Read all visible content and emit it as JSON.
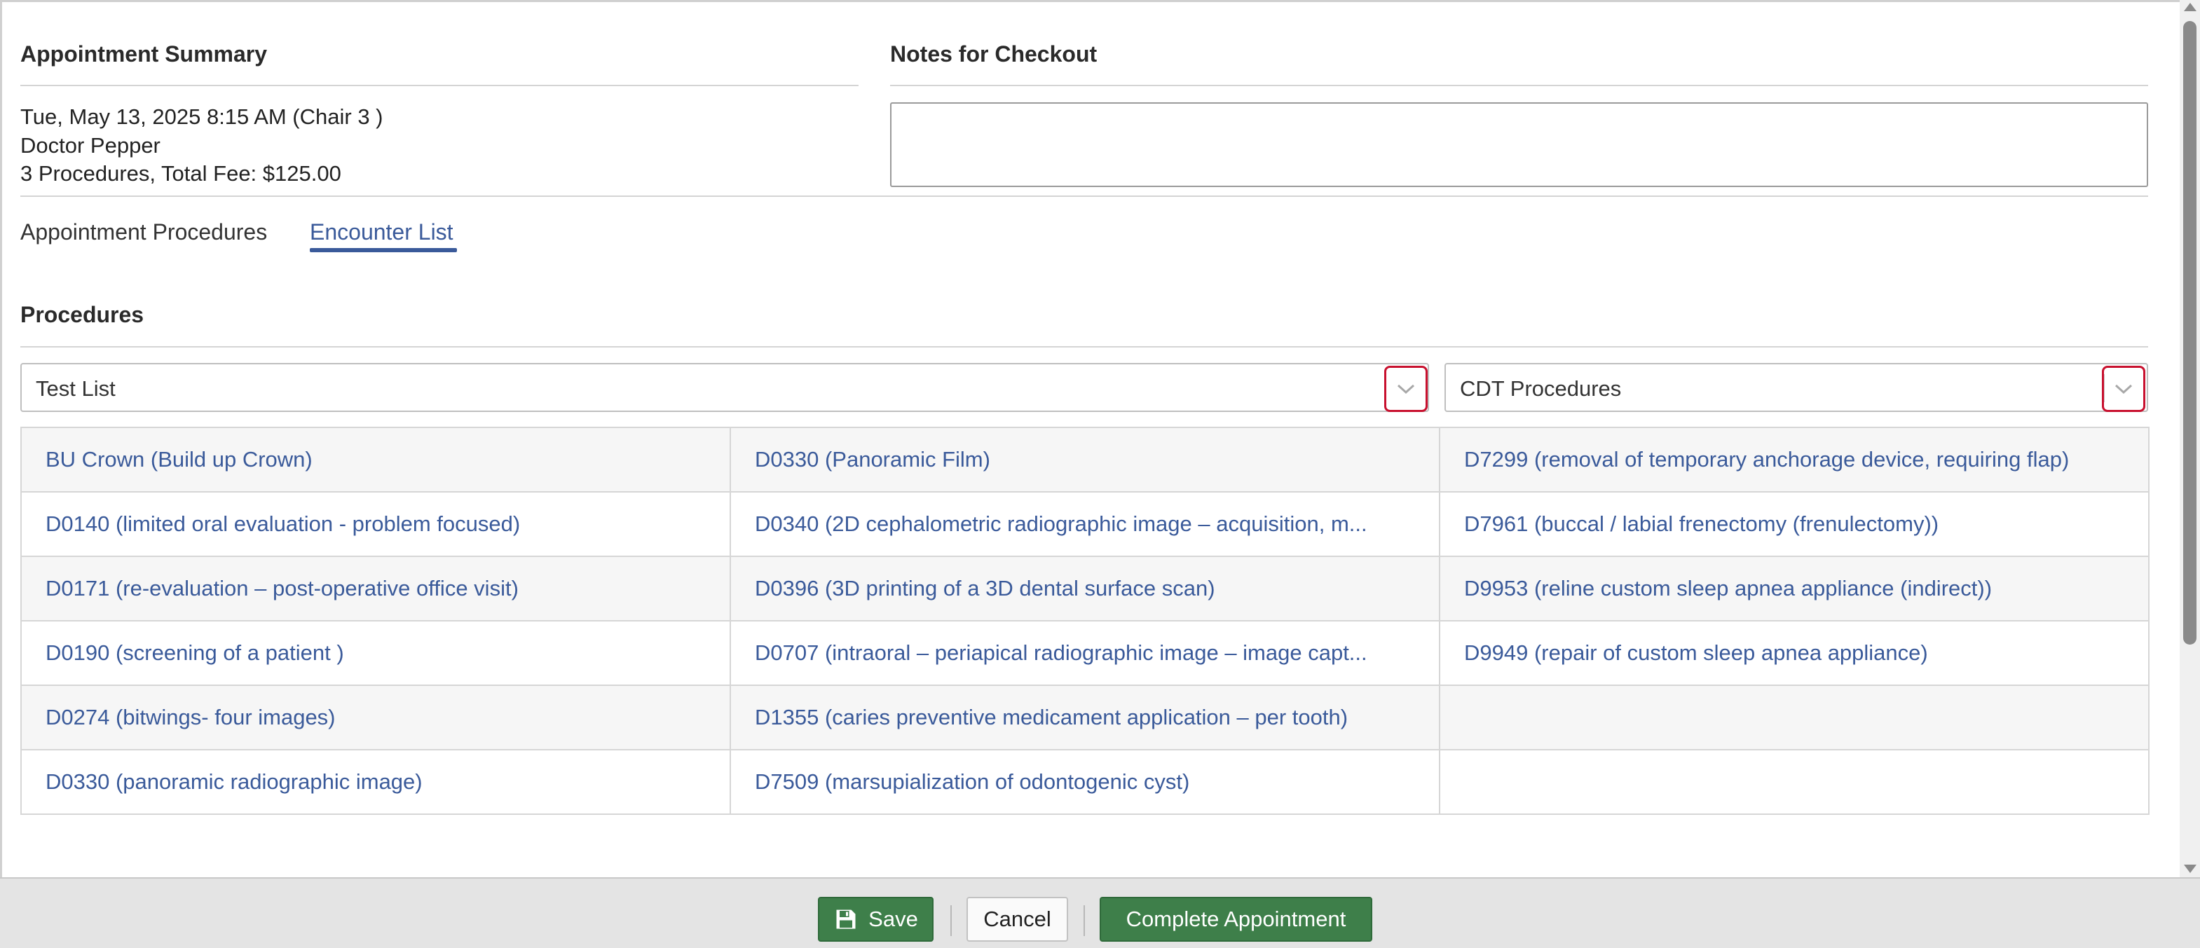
{
  "summary": {
    "title": "Appointment Summary",
    "date_line": "Tue, May 13, 2025 8:15 AM (Chair 3 )",
    "doctor_line": "Doctor Pepper",
    "fee_line": "3 Procedures, Total Fee: $125.00"
  },
  "notes": {
    "title": "Notes for Checkout",
    "value": ""
  },
  "tabs": [
    {
      "label": "Appointment Procedures",
      "active": false
    },
    {
      "label": "Encounter List",
      "active": true
    }
  ],
  "procedures": {
    "title": "Procedures",
    "list_select": "Test List",
    "code_select": "CDT Procedures",
    "rows": [
      [
        "BU Crown (Build up Crown)",
        "D0330 (Panoramic Film)",
        "D7299 (removal of temporary anchorage device, requiring flap)"
      ],
      [
        "D0140 (limited oral evaluation - problem focused)",
        "D0340 (2D cephalometric radiographic image – acquisition, m...",
        "D7961 (buccal / labial frenectomy (frenulectomy))"
      ],
      [
        "D0171 (re-evaluation – post-operative office visit)",
        "D0396 (3D printing of a 3D dental surface scan)",
        "D9953 (reline custom sleep apnea appliance (indirect))"
      ],
      [
        "D0190 (screening of a patient )",
        "D0707 (intraoral – periapical radiographic image – image capt...",
        "D9949 (repair of custom sleep apnea appliance)"
      ],
      [
        "D0274 (bitwings- four images)",
        "D1355 (caries preventive medicament application – per tooth)",
        ""
      ],
      [
        "D0330 (panoramic radiographic image)",
        "D7509 (marsupialization of odontogenic cyst)",
        ""
      ]
    ]
  },
  "footer": {
    "save_label": "Save",
    "cancel_label": "Cancel",
    "complete_label": "Complete Appointment"
  },
  "icons": {
    "save": "save-icon",
    "dropdown": "chevron-down-icon"
  },
  "colors": {
    "accent": "#3a5a9a",
    "primary_button": "#3e7f4a",
    "highlight_border": "#c8102e"
  }
}
